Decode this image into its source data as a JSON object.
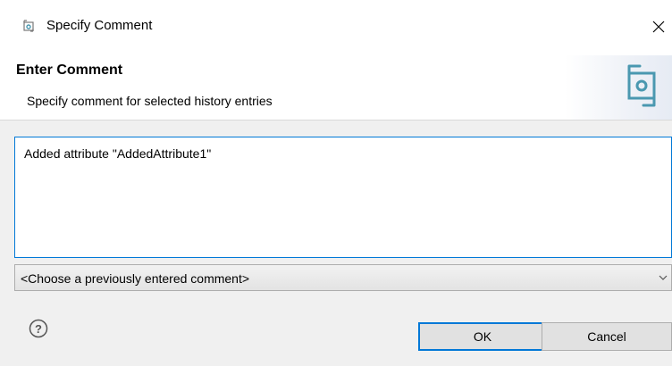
{
  "window": {
    "title": "Specify Comment",
    "icon": "history-sync-icon",
    "close_glyph": "✕"
  },
  "header": {
    "title": "Enter Comment",
    "description": "Specify comment for selected history entries",
    "icon": "history-sync-icon"
  },
  "comment": {
    "value": "Added attribute \"AddedAttribute1\""
  },
  "previous_comments": {
    "selected": "<Choose a previously entered comment>"
  },
  "buttons": {
    "help_glyph": "?",
    "ok": "OK",
    "cancel": "Cancel"
  },
  "colors": {
    "accent": "#0078d7",
    "dialog_bg": "#f0f0f0",
    "icon_gray": "#7a7a7a",
    "icon_teal": "#4a98b0"
  }
}
